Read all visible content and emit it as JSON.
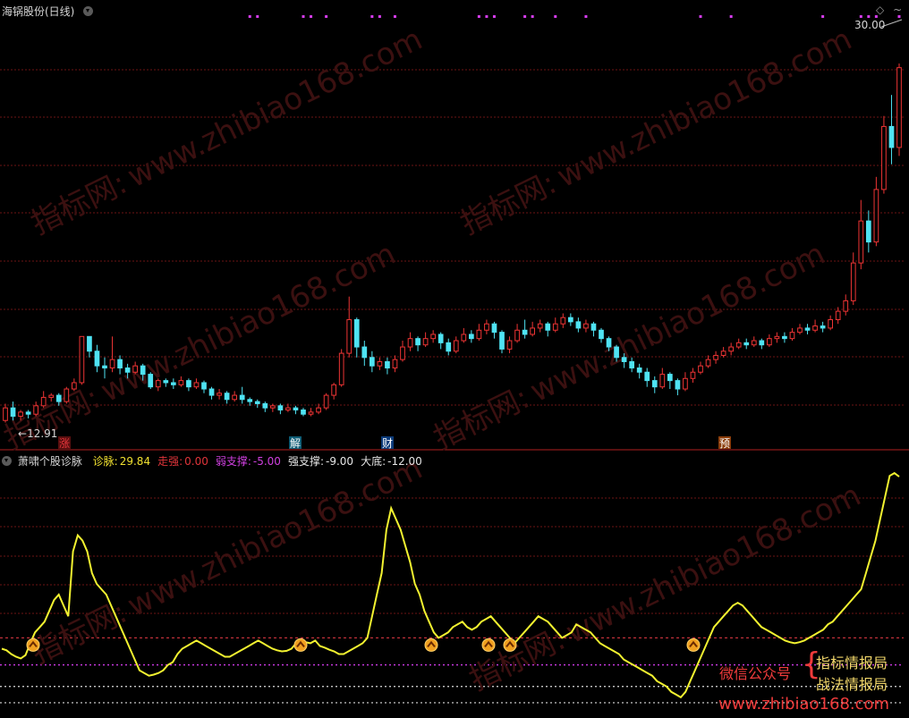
{
  "header": {
    "stock_title": "海锅股份(日线)",
    "top_right_value": "30.00",
    "top_right_icon": "diamond-icon",
    "low_label": "12.91"
  },
  "event_markers": [
    {
      "label": "涨",
      "color": "#e0343a",
      "bg": "#5a0f0f"
    },
    {
      "label": "解",
      "color": "#ffffff",
      "bg": "#0d5b74"
    },
    {
      "label": "财",
      "color": "#ffffff",
      "bg": "#0c3b7a"
    },
    {
      "label": "预",
      "color": "#ffffff",
      "bg": "#8a3c0a"
    }
  ],
  "indicator": {
    "name": "萧啸个股诊脉",
    "items": [
      {
        "label": "诊脉:",
        "value": "29.84",
        "color": "#f0e030"
      },
      {
        "label": "走强:",
        "value": "0.00",
        "color": "#e0343a"
      },
      {
        "label": "弱支撑:",
        "value": "-5.00",
        "color": "#d040e0"
      },
      {
        "label": "强支撑:",
        "value": "-9.00",
        "color": "#e6e6e6"
      },
      {
        "label": "大底:",
        "value": "-12.00",
        "color": "#e6e6e6"
      }
    ]
  },
  "watermarks": {
    "site": "www.zhibiao168.com",
    "cn": "指标网:"
  },
  "promo": {
    "wechat_label": "微信公众号",
    "line1": "指标情报局",
    "line2": "战法情报局",
    "site": "www.zhibiao168.com"
  },
  "colors": {
    "up": "#ee3434",
    "down": "#4fe3f3",
    "line": "#f2f230",
    "grid": "#6b1414",
    "magenta": "#d63cf0",
    "promo_red": "#ef3b3b",
    "promo_gold": "#f2d76a"
  },
  "chart_data": [
    {
      "type": "candlestick",
      "title": "海锅股份(日线)",
      "y_range": [
        12.5,
        32.0
      ],
      "labeled_values": {
        "max": 30.0,
        "min": 12.91
      },
      "top_markers": [
        32,
        33,
        39,
        40,
        42,
        48,
        49,
        51,
        62,
        63,
        64,
        68,
        69,
        72,
        76,
        91,
        95,
        107,
        112,
        113,
        114,
        117,
        128,
        132,
        140,
        147
      ],
      "candles": [
        [
          13.0,
          13.6,
          13.8,
          12.9
        ],
        [
          13.6,
          13.2,
          13.9,
          13.0
        ],
        [
          13.2,
          13.4,
          13.5,
          13.0
        ],
        [
          13.4,
          13.3,
          13.5,
          13.1
        ],
        [
          13.3,
          13.7,
          13.9,
          13.2
        ],
        [
          13.7,
          14.1,
          14.4,
          13.6
        ],
        [
          14.1,
          14.2,
          14.3,
          13.9
        ],
        [
          14.2,
          13.9,
          14.3,
          13.7
        ],
        [
          13.9,
          14.5,
          14.6,
          13.8
        ],
        [
          14.5,
          14.8,
          15.0,
          14.4
        ],
        [
          14.8,
          17.0,
          17.0,
          14.7
        ],
        [
          17.0,
          16.3,
          17.0,
          16.0
        ],
        [
          16.3,
          15.6,
          16.6,
          15.3
        ],
        [
          15.6,
          15.5,
          16.0,
          15.0
        ],
        [
          15.5,
          15.9,
          17.0,
          15.3
        ],
        [
          15.9,
          15.5,
          16.1,
          15.2
        ],
        [
          15.5,
          15.3,
          15.7,
          15.0
        ],
        [
          15.3,
          15.6,
          15.8,
          15.2
        ],
        [
          15.6,
          15.2,
          15.7,
          14.9
        ],
        [
          15.2,
          14.6,
          15.3,
          14.5
        ],
        [
          14.6,
          14.9,
          15.0,
          14.4
        ],
        [
          14.9,
          14.8,
          15.0,
          14.6
        ],
        [
          14.8,
          14.7,
          15.0,
          14.5
        ],
        [
          14.7,
          14.9,
          15.1,
          14.6
        ],
        [
          14.9,
          14.6,
          15.0,
          14.4
        ],
        [
          14.6,
          14.8,
          15.0,
          14.5
        ],
        [
          14.8,
          14.5,
          14.9,
          14.3
        ],
        [
          14.5,
          14.2,
          14.6,
          14.0
        ],
        [
          14.2,
          14.3,
          14.5,
          14.0
        ],
        [
          14.3,
          14.0,
          14.4,
          13.8
        ],
        [
          14.0,
          14.2,
          14.4,
          13.9
        ],
        [
          14.2,
          14.0,
          14.6,
          13.8
        ],
        [
          14.0,
          13.9,
          14.1,
          13.7
        ],
        [
          13.9,
          13.8,
          14.0,
          13.6
        ],
        [
          13.8,
          13.6,
          13.9,
          13.4
        ],
        [
          13.6,
          13.7,
          13.8,
          13.4
        ],
        [
          13.7,
          13.5,
          13.8,
          13.3
        ],
        [
          13.5,
          13.6,
          13.8,
          13.4
        ],
        [
          13.6,
          13.5,
          13.7,
          13.3
        ],
        [
          13.5,
          13.3,
          13.6,
          13.2
        ],
        [
          13.3,
          13.4,
          13.6,
          13.2
        ],
        [
          13.4,
          13.6,
          13.8,
          13.3
        ],
        [
          13.6,
          14.2,
          14.3,
          13.5
        ],
        [
          14.2,
          14.7,
          14.8,
          14.0
        ],
        [
          14.7,
          16.2,
          16.4,
          14.6
        ],
        [
          16.2,
          17.8,
          18.9,
          16.0
        ],
        [
          17.8,
          16.5,
          17.9,
          16.0
        ],
        [
          16.5,
          16.0,
          16.8,
          15.6
        ],
        [
          16.0,
          15.6,
          16.3,
          15.3
        ],
        [
          15.6,
          15.8,
          16.0,
          15.4
        ],
        [
          15.8,
          15.5,
          16.0,
          15.2
        ],
        [
          15.5,
          15.9,
          16.1,
          15.3
        ],
        [
          15.9,
          16.5,
          16.8,
          15.8
        ],
        [
          16.5,
          16.9,
          17.2,
          16.3
        ],
        [
          16.9,
          16.6,
          17.0,
          16.3
        ],
        [
          16.6,
          16.9,
          17.2,
          16.5
        ],
        [
          16.9,
          17.1,
          17.3,
          16.7
        ],
        [
          17.1,
          16.7,
          17.2,
          16.4
        ],
        [
          16.7,
          16.3,
          16.9,
          16.1
        ],
        [
          16.3,
          16.8,
          17.0,
          16.2
        ],
        [
          16.8,
          17.1,
          17.4,
          16.7
        ],
        [
          17.1,
          16.9,
          17.3,
          16.7
        ],
        [
          16.9,
          17.3,
          17.6,
          16.8
        ],
        [
          17.3,
          17.6,
          17.8,
          17.1
        ],
        [
          17.6,
          17.2,
          17.7,
          16.9
        ],
        [
          17.2,
          16.4,
          17.3,
          16.2
        ],
        [
          16.4,
          16.8,
          17.0,
          16.2
        ],
        [
          16.8,
          17.3,
          17.6,
          16.7
        ],
        [
          17.3,
          17.1,
          17.8,
          16.9
        ],
        [
          17.1,
          17.4,
          17.7,
          17.0
        ],
        [
          17.4,
          17.6,
          17.8,
          17.2
        ],
        [
          17.6,
          17.3,
          17.7,
          17.0
        ],
        [
          17.3,
          17.6,
          17.9,
          17.2
        ],
        [
          17.6,
          17.9,
          18.1,
          17.4
        ],
        [
          17.9,
          17.7,
          18.1,
          17.5
        ],
        [
          17.7,
          17.4,
          17.9,
          17.2
        ],
        [
          17.4,
          17.6,
          17.8,
          17.2
        ],
        [
          17.6,
          17.3,
          17.7,
          17.0
        ],
        [
          17.3,
          16.9,
          17.4,
          16.7
        ],
        [
          16.9,
          16.5,
          17.0,
          16.3
        ],
        [
          16.5,
          16.0,
          16.6,
          15.8
        ],
        [
          16.0,
          15.8,
          16.2,
          15.5
        ],
        [
          15.8,
          15.5,
          16.0,
          15.3
        ],
        [
          15.5,
          15.3,
          15.7,
          15.0
        ],
        [
          15.3,
          14.9,
          15.5,
          14.6
        ],
        [
          14.9,
          14.6,
          15.1,
          14.3
        ],
        [
          14.6,
          15.2,
          15.5,
          14.5
        ],
        [
          15.2,
          14.9,
          15.3,
          14.5
        ],
        [
          14.9,
          14.5,
          15.0,
          14.2
        ],
        [
          14.5,
          15.0,
          15.3,
          14.4
        ],
        [
          15.0,
          15.3,
          15.5,
          14.8
        ],
        [
          15.3,
          15.6,
          15.8,
          15.2
        ],
        [
          15.6,
          15.9,
          16.1,
          15.5
        ],
        [
          15.9,
          16.1,
          16.3,
          15.7
        ],
        [
          16.1,
          16.3,
          16.5,
          16.0
        ],
        [
          16.3,
          16.5,
          16.7,
          16.1
        ],
        [
          16.5,
          16.7,
          16.9,
          16.4
        ],
        [
          16.7,
          16.6,
          16.9,
          16.4
        ],
        [
          16.6,
          16.8,
          17.0,
          16.5
        ],
        [
          16.8,
          16.6,
          16.9,
          16.4
        ],
        [
          16.6,
          16.9,
          17.1,
          16.5
        ],
        [
          16.9,
          17.0,
          17.2,
          16.7
        ],
        [
          17.0,
          16.9,
          17.2,
          16.7
        ],
        [
          16.9,
          17.2,
          17.4,
          16.8
        ],
        [
          17.2,
          17.4,
          17.6,
          17.1
        ],
        [
          17.4,
          17.3,
          17.6,
          17.1
        ],
        [
          17.3,
          17.5,
          17.8,
          17.2
        ],
        [
          17.5,
          17.4,
          17.7,
          17.2
        ],
        [
          17.4,
          17.8,
          18.0,
          17.3
        ],
        [
          17.8,
          18.2,
          18.4,
          17.6
        ],
        [
          18.2,
          18.7,
          19.0,
          18.0
        ],
        [
          18.7,
          20.5,
          21.0,
          18.5
        ],
        [
          20.5,
          22.5,
          23.5,
          20.2
        ],
        [
          22.5,
          21.5,
          23.0,
          21.0
        ],
        [
          21.5,
          24.0,
          24.6,
          21.3
        ],
        [
          24.0,
          27.0,
          27.5,
          23.8
        ],
        [
          27.0,
          26.0,
          28.5,
          25.2
        ],
        [
          26.0,
          29.8,
          30.0,
          25.6
        ]
      ]
    },
    {
      "type": "line",
      "title": "萧啸个股诊脉",
      "series": [
        {
          "name": "诊脉",
          "color": "#f2f230"
        }
      ],
      "y_range": [
        -14,
        32
      ],
      "reference_lines": [
        {
          "name": "走强",
          "value": 0.0
        },
        {
          "name": "弱支撑",
          "value": -5.0
        },
        {
          "name": "强支撑",
          "value": -9.0
        },
        {
          "name": "大底",
          "value": -12.0
        }
      ],
      "values": [
        -2,
        -2.3,
        -3,
        -3.5,
        -3.8,
        -3.2,
        -1,
        1,
        2,
        3,
        5,
        7,
        8,
        6,
        4,
        16,
        19,
        18,
        16,
        12,
        10,
        9,
        8,
        6,
        4,
        2,
        0,
        -2,
        -4,
        -6,
        -6.5,
        -7,
        -6.8,
        -6.5,
        -6,
        -5,
        -4.5,
        -3,
        -2,
        -1.5,
        -1,
        -0.5,
        -1,
        -1.5,
        -2,
        -2.5,
        -3,
        -3.5,
        -3.5,
        -3,
        -2.5,
        -2,
        -1.5,
        -1,
        -0.5,
        -1,
        -1.5,
        -2,
        -2.3,
        -2.5,
        -2.4,
        -2,
        -1,
        -0.5,
        -0.8,
        -1,
        -0.5,
        -1.5,
        -1.8,
        -2.2,
        -2.5,
        -3,
        -3,
        -2.5,
        -2,
        -1.5,
        -1,
        0,
        4,
        8,
        12,
        20,
        24,
        22,
        20,
        17,
        14,
        10,
        8,
        5,
        3,
        1,
        0,
        0.5,
        1,
        2,
        2.5,
        3,
        2,
        1.5,
        2,
        3,
        3.5,
        4,
        3,
        2,
        1,
        0,
        -1,
        0,
        1,
        2,
        3,
        4,
        3.5,
        3,
        2,
        1,
        0,
        0.5,
        1,
        2.5,
        2,
        1.5,
        1,
        0,
        -1,
        -1.5,
        -2,
        -2.5,
        -3,
        -4,
        -4.5,
        -5,
        -5.5,
        -6,
        -6.5,
        -7,
        -8,
        -8.5,
        -9,
        -10,
        -10.5,
        -11,
        -10,
        -8,
        -6,
        -4,
        -2,
        0,
        2,
        3,
        4,
        5,
        6,
        6.5,
        6,
        5,
        4,
        3,
        2,
        1.5,
        1,
        0.5,
        0,
        -0.5,
        -0.8,
        -1,
        -0.8,
        -0.5,
        0,
        0.5,
        1,
        1.5,
        2.5,
        3,
        4,
        5,
        6,
        7,
        8,
        9,
        12,
        15,
        18,
        22,
        26,
        30,
        30.5,
        29.84
      ]
    }
  ]
}
